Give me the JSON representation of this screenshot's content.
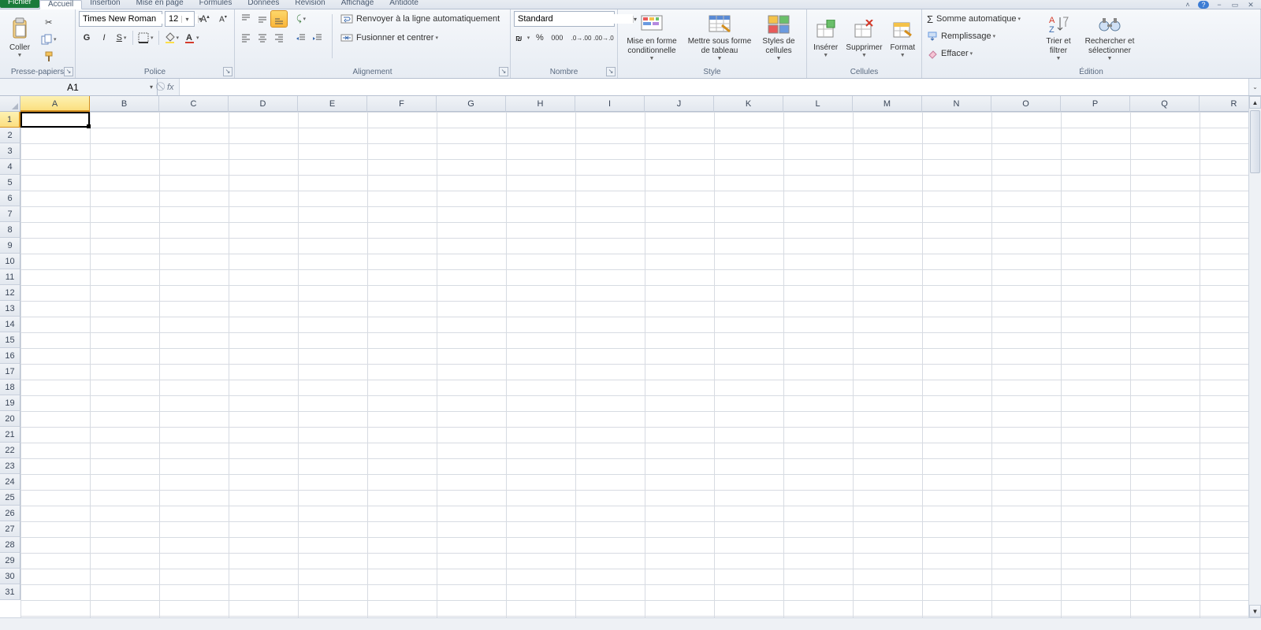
{
  "tabs": {
    "file": "Fichier",
    "list": [
      "Accueil",
      "Insertion",
      "Mise en page",
      "Formules",
      "Données",
      "Révision",
      "Affichage",
      "Antidote"
    ],
    "activeIndex": 0
  },
  "ribbon": {
    "clipboard": {
      "paste": "Coller",
      "label": "Presse-papiers"
    },
    "font": {
      "family": "Times New Roman",
      "size": "12",
      "label": "Police",
      "bold": "G",
      "italic": "I",
      "underline": "S"
    },
    "alignment": {
      "wrap": "Renvoyer à la ligne automatiquement",
      "merge": "Fusionner et centrer",
      "label": "Alignement"
    },
    "number": {
      "format": "Standard",
      "label": "Nombre",
      "percent": "%",
      "thousands": "000"
    },
    "style": {
      "cond": "Mise en forme conditionnelle",
      "table": "Mettre sous forme de tableau",
      "styles": "Styles de cellules",
      "label": "Style"
    },
    "cells": {
      "insert": "Insérer",
      "delete": "Supprimer",
      "format": "Format",
      "label": "Cellules"
    },
    "editing": {
      "autosum": "Somme automatique",
      "fill": "Remplissage",
      "clear": "Effacer",
      "sort": "Trier et filtrer",
      "find": "Rechercher et sélectionner",
      "label": "Édition"
    }
  },
  "namebox": {
    "value": "A1"
  },
  "formula": {
    "value": ""
  },
  "grid": {
    "columns": [
      "A",
      "B",
      "C",
      "D",
      "E",
      "F",
      "G",
      "H",
      "I",
      "J",
      "K",
      "L",
      "M",
      "N",
      "O",
      "P",
      "Q",
      "R"
    ],
    "rows": [
      1,
      2,
      3,
      4,
      5,
      6,
      7,
      8,
      9,
      10,
      11,
      12,
      13,
      14,
      15,
      16,
      17,
      18,
      19,
      20,
      21,
      22,
      23,
      24,
      25,
      26,
      27,
      28,
      29,
      30,
      31
    ],
    "selectedCol": "A",
    "selectedRow": 1
  }
}
